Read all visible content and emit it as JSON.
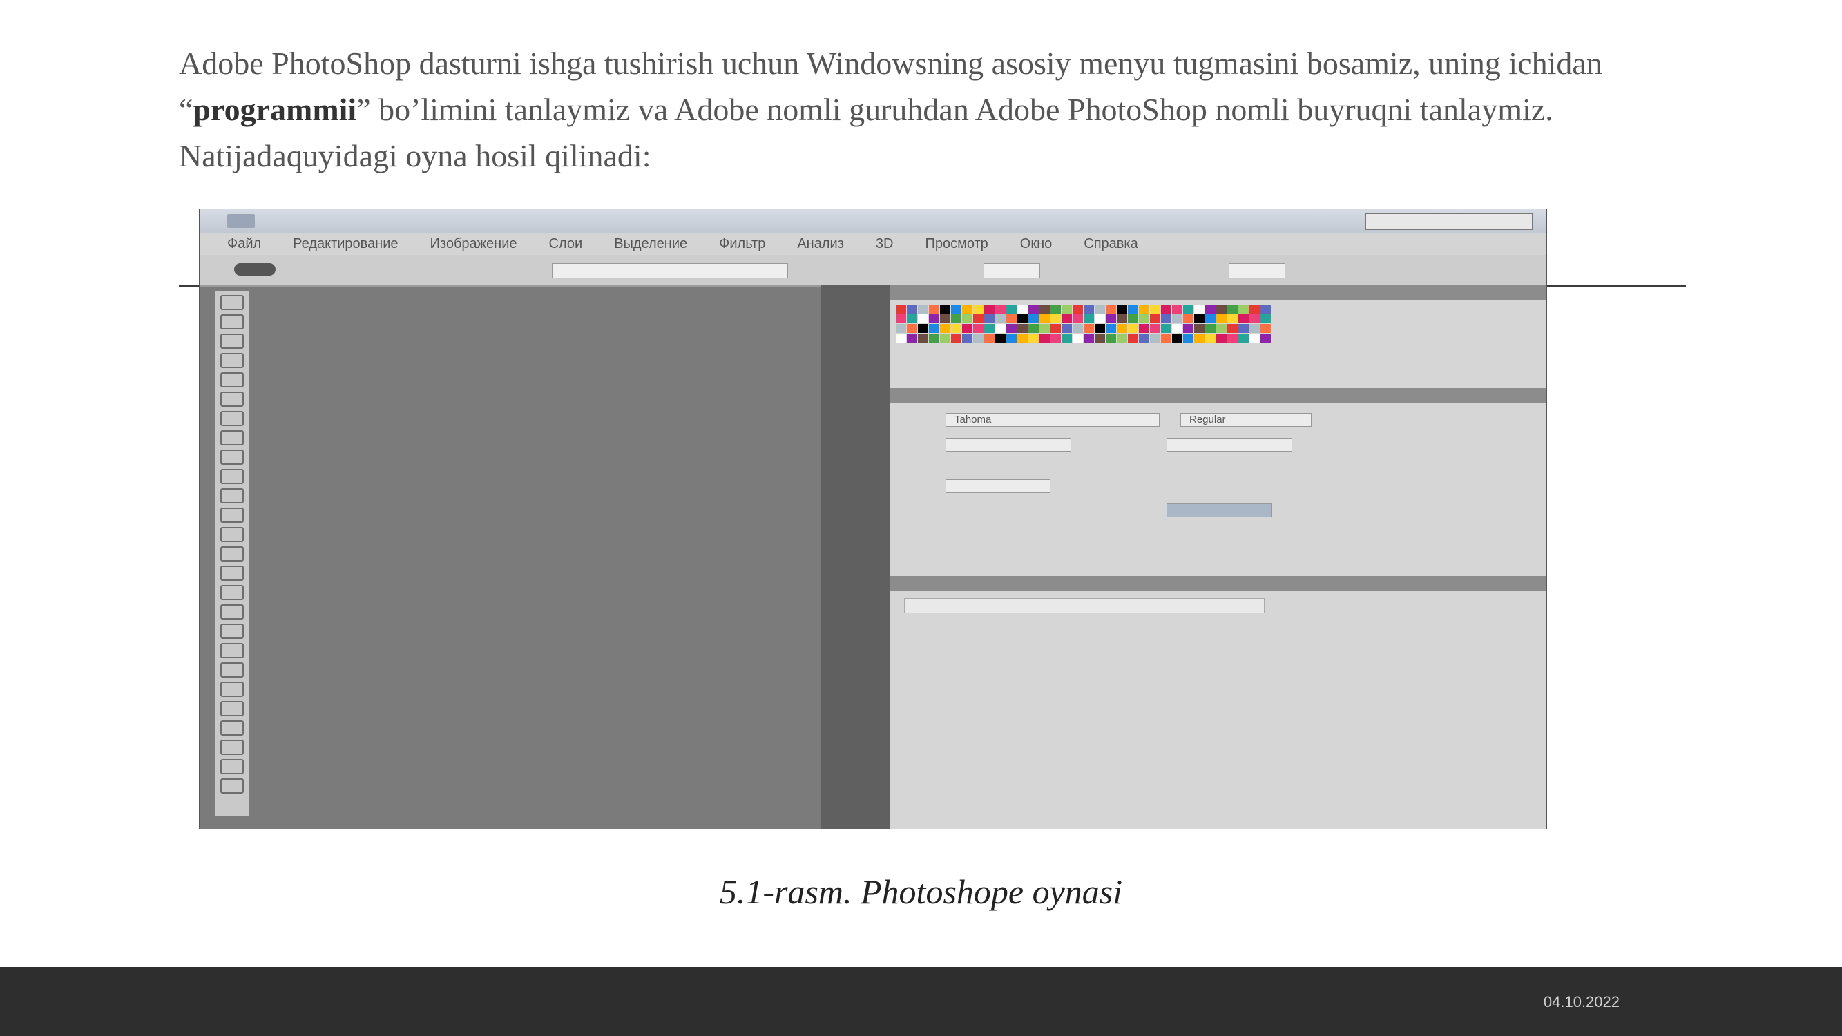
{
  "paragraph": {
    "part1": "Adobe PhotoShop dasturni ishga tushirish uchun Windowsning asosiy menyu tugmasini bosamiz, uning ichidan “",
    "bold": "programmii",
    "part2": "” bo’limini tanlaymiz va Adobe nomli guruhdan Adobe PhotoShop nomli buyruqni tanlaymiz. Natijadaquyidagi oyna hosil qilinadi:"
  },
  "screenshot": {
    "menu": [
      "Файл",
      "Редактирование",
      "Изображение",
      "Слои",
      "Выделение",
      "Фильтр",
      "Анализ",
      "3D",
      "Просмотр",
      "Окно",
      "Справка"
    ],
    "font_name": "Tahoma",
    "font_style": "Regular"
  },
  "caption": "5.1-rasm. Photoshope oynasi",
  "footer": {
    "date": "04.10.2022"
  }
}
